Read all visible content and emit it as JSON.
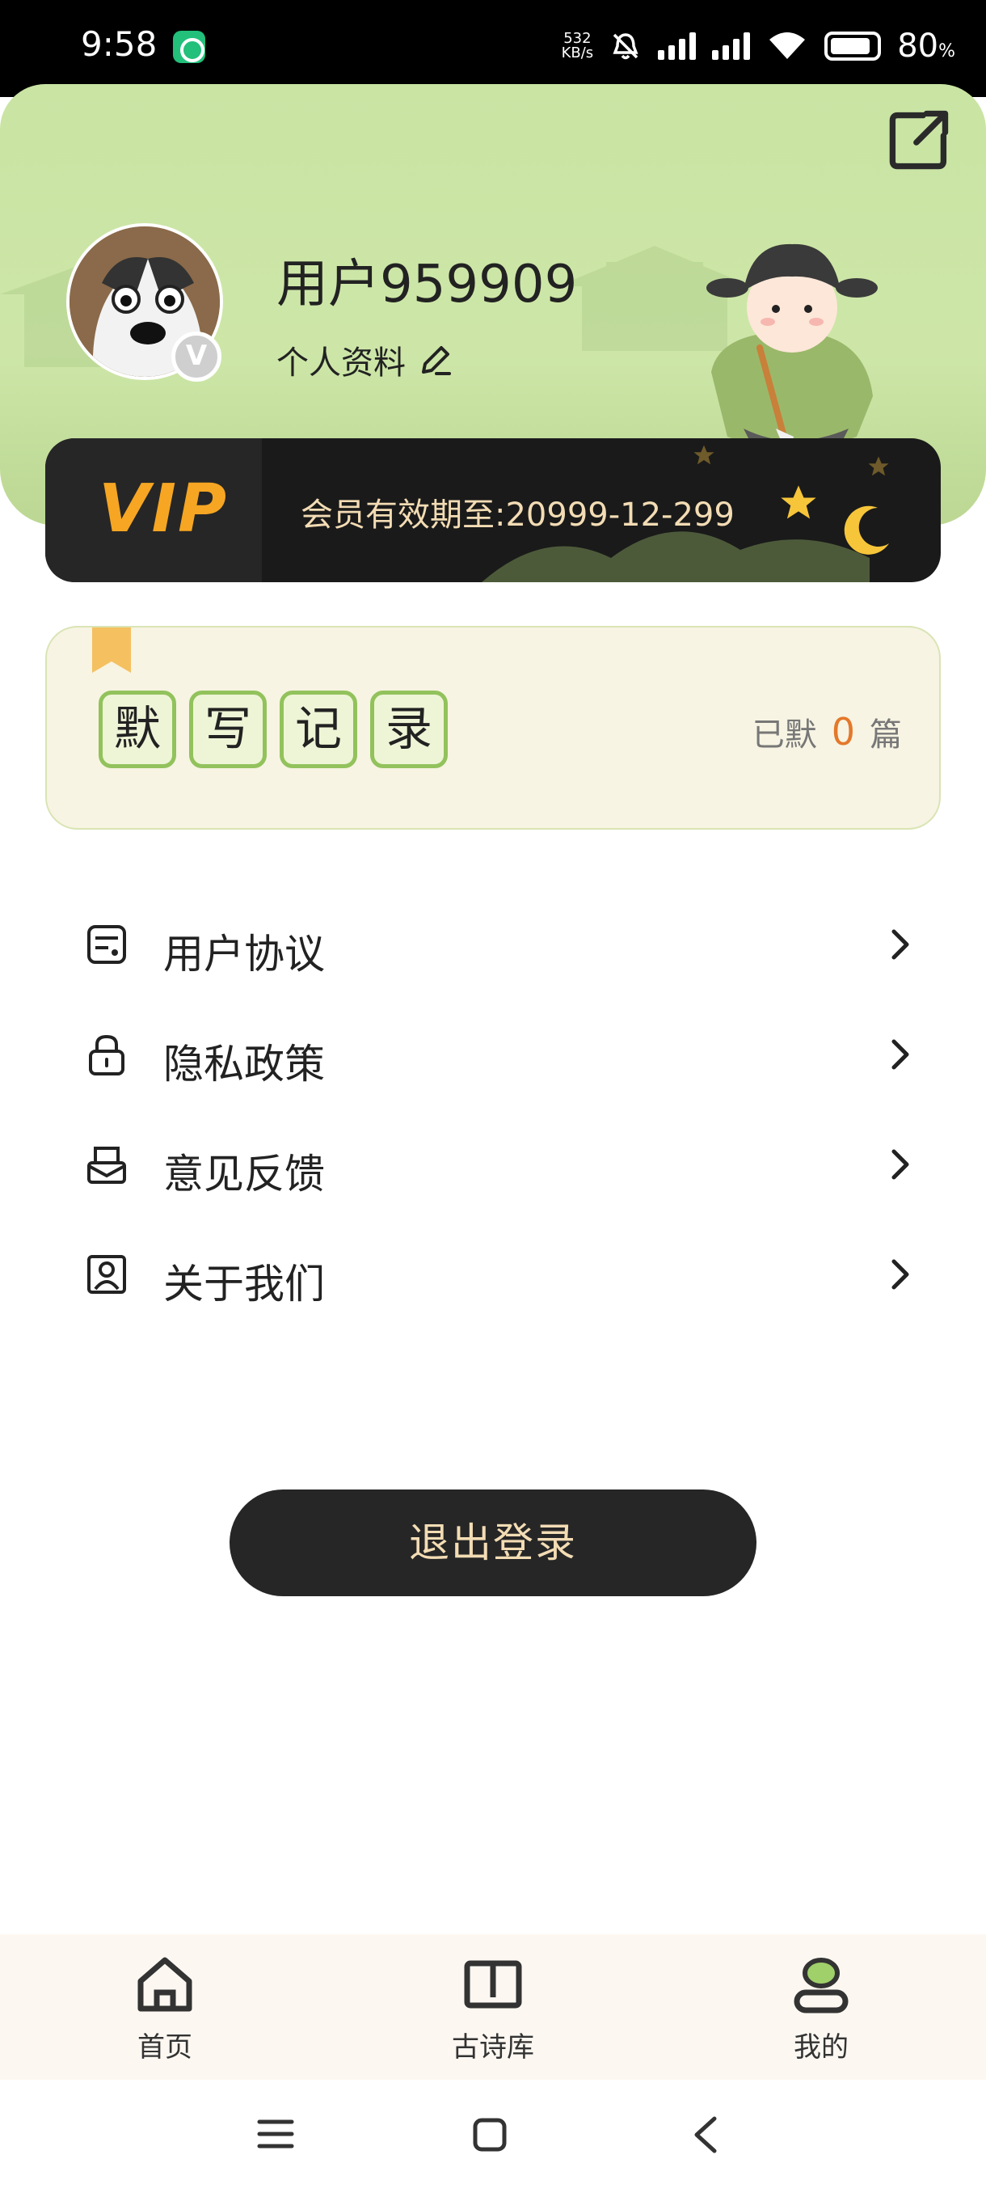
{
  "status_bar": {
    "time": "9:58",
    "net_speed_value": "532",
    "net_speed_unit": "KB/s",
    "battery": "80",
    "battery_unit": "%"
  },
  "profile": {
    "username": "用户959909",
    "edit_profile_label": "个人资料",
    "badge": "V"
  },
  "vip": {
    "logo": "VIP",
    "expiry_text": "会员有效期至:20999-12-299"
  },
  "dictation_record": {
    "title_chars": [
      "默",
      "写",
      "记",
      "录"
    ],
    "count_prefix": "已默",
    "count_value": "0",
    "count_suffix": "篇"
  },
  "menu": [
    {
      "label": "用户协议",
      "icon": "document-icon"
    },
    {
      "label": "隐私政策",
      "icon": "lock-icon"
    },
    {
      "label": "意见反馈",
      "icon": "feedback-mailbox-icon"
    },
    {
      "label": "关于我们",
      "icon": "person-card-icon"
    }
  ],
  "logout_label": "退出登录",
  "tabs": [
    {
      "label": "首页",
      "icon": "home-icon"
    },
    {
      "label": "古诗库",
      "icon": "book-icon"
    },
    {
      "label": "我的",
      "icon": "profile-icon",
      "active": true
    }
  ],
  "colors": {
    "header_green": "#c9e4a3",
    "vip_gold": "#f6a623",
    "accent_orange": "#e4782a",
    "tile_border": "#92c25c",
    "dark_button": "#262626"
  }
}
